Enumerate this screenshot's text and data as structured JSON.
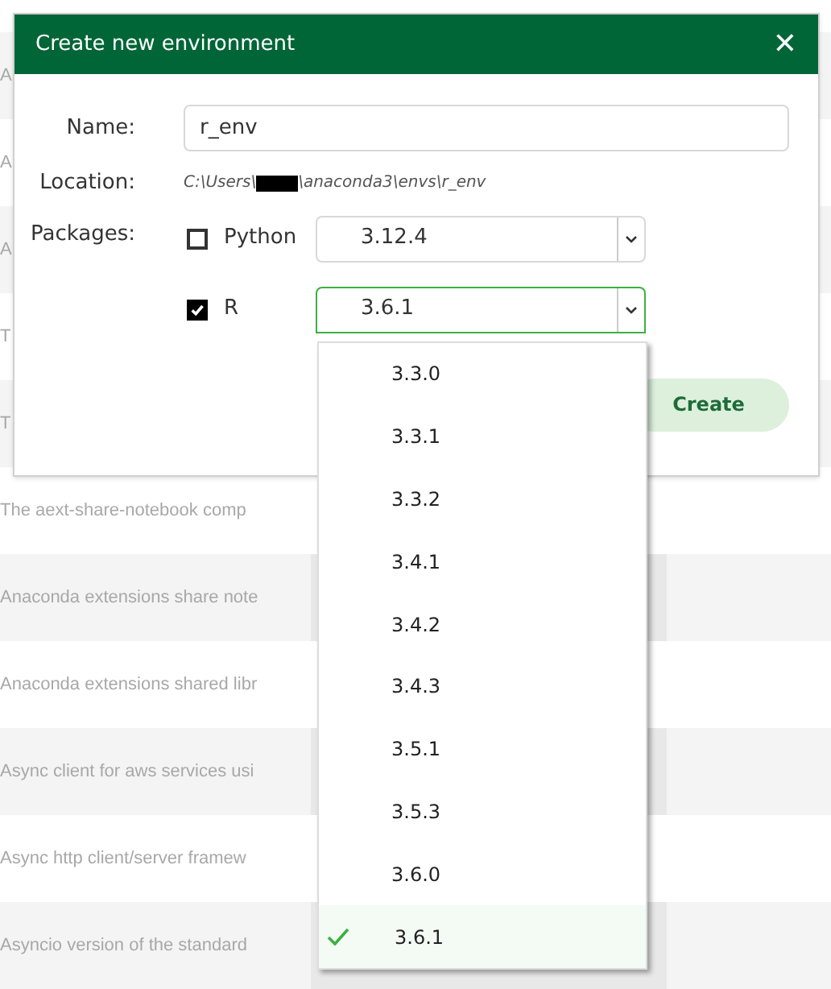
{
  "background_rows": [
    {
      "text": "A"
    },
    {
      "text": "A"
    },
    {
      "text": "A"
    },
    {
      "text": "T"
    },
    {
      "text": "T"
    },
    {
      "text": "The aext-share-notebook comp"
    },
    {
      "text": "Anaconda extensions share note"
    },
    {
      "text": "Anaconda extensions shared libr"
    },
    {
      "text": "Async client for aws services usi"
    },
    {
      "text": "Async http client/server framew"
    },
    {
      "text": "Asyncio version of the standard"
    }
  ],
  "dialog": {
    "title": "Create new environment",
    "close": "✕",
    "name_label": "Name:",
    "name_value": "r_env",
    "location_label": "Location:",
    "location_prefix": "C:\\Users\\",
    "location_suffix": "\\anaconda3\\envs\\r_env",
    "packages_label": "Packages:",
    "packages": [
      {
        "name": "Python",
        "checked": false,
        "version": "3.12.4",
        "open": false
      },
      {
        "name": "R",
        "checked": true,
        "version": "3.6.1",
        "open": true
      }
    ],
    "create_button": "Create"
  },
  "dropdown": {
    "items": [
      {
        "label": "3.3.0",
        "selected": false
      },
      {
        "label": "3.3.1",
        "selected": false
      },
      {
        "label": "3.3.2",
        "selected": false
      },
      {
        "label": "3.4.1",
        "selected": false
      },
      {
        "label": "3.4.2",
        "selected": false
      },
      {
        "label": "3.4.3",
        "selected": false
      },
      {
        "label": "3.5.1",
        "selected": false
      },
      {
        "label": "3.5.3",
        "selected": false
      },
      {
        "label": "3.6.0",
        "selected": false
      },
      {
        "label": "3.6.1",
        "selected": true
      }
    ]
  }
}
